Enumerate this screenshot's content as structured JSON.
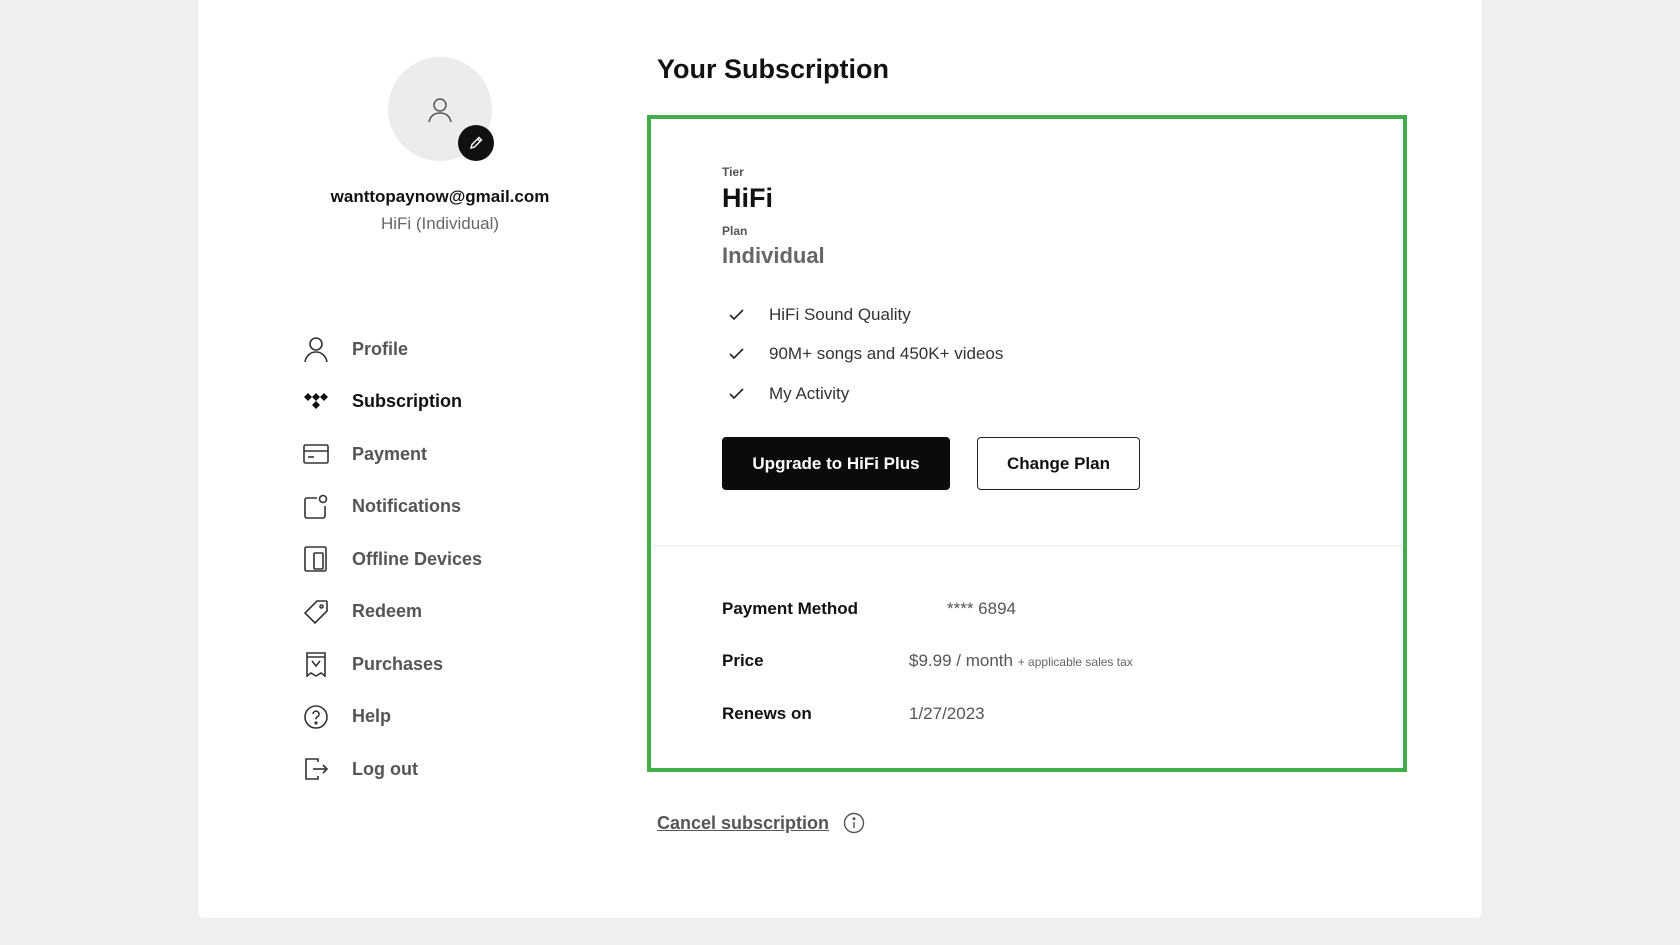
{
  "user": {
    "email": "wanttopaynow@gmail.com",
    "plan_summary": "HiFi (Individual)"
  },
  "nav": {
    "items": [
      {
        "label": "Profile",
        "icon": "person-icon",
        "active": false
      },
      {
        "label": "Subscription",
        "icon": "tidal-logo-icon",
        "active": true
      },
      {
        "label": "Payment",
        "icon": "credit-card-icon",
        "active": false
      },
      {
        "label": "Notifications",
        "icon": "notification-icon",
        "active": false
      },
      {
        "label": "Offline Devices",
        "icon": "devices-icon",
        "active": false
      },
      {
        "label": "Redeem",
        "icon": "tag-icon",
        "active": false
      },
      {
        "label": "Purchases",
        "icon": "receipt-icon",
        "active": false
      },
      {
        "label": "Help",
        "icon": "help-circle-icon",
        "active": false
      },
      {
        "label": "Log out",
        "icon": "logout-icon",
        "active": false
      }
    ]
  },
  "main": {
    "title": "Your Subscription",
    "tier_label": "Tier",
    "tier_value": "HiFi",
    "plan_label": "Plan",
    "plan_value": "Individual",
    "features": [
      "HiFi Sound Quality",
      "90M+ songs and 450K+ videos",
      "My Activity"
    ],
    "upgrade_label": "Upgrade to HiFi Plus",
    "change_plan_label": "Change Plan",
    "payment_method_label": "Payment Method",
    "payment_method_value": "**** 6894",
    "price_label": "Price",
    "price_value": "$9.99 / month",
    "price_note": "+ applicable sales tax",
    "renews_label": "Renews on",
    "renews_value": "1/27/2023",
    "cancel_label": "Cancel subscription"
  },
  "colors": {
    "highlight_border": "#3fae4a",
    "primary_button": "#0b0b0b",
    "page_background": "#efefef"
  }
}
